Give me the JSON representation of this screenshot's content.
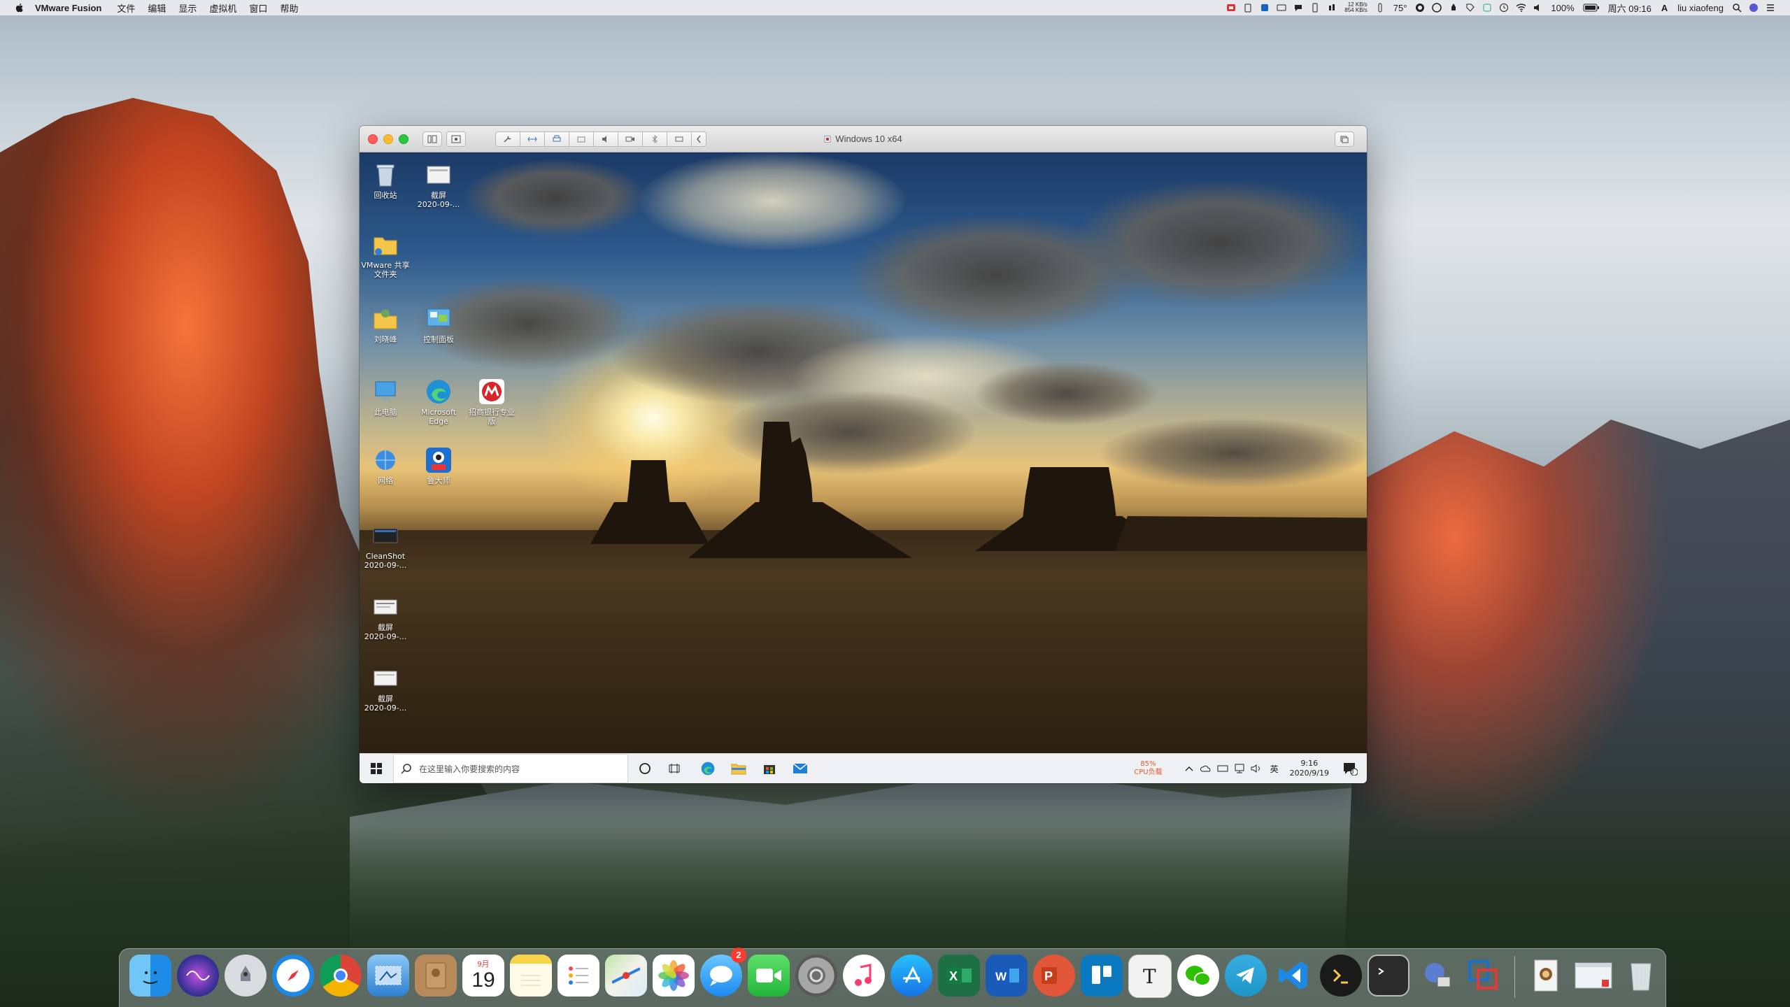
{
  "menubar": {
    "app_name": "VMware Fusion",
    "menus": [
      "文件",
      "编辑",
      "显示",
      "虚拟机",
      "窗口",
      "帮助"
    ],
    "net_up": "12 KB/s",
    "net_down": "854 KB/s",
    "temperature": "75°",
    "battery": "100%",
    "datetime": "周六 09:16",
    "input_source": "A",
    "username": "liu xiaofeng"
  },
  "vm_window": {
    "title": "Windows 10 x64"
  },
  "guest_desktop": {
    "icons": [
      {
        "label": "回收站",
        "name": "recycle-bin"
      },
      {
        "label": "截屏\n2020-09-...",
        "name": "screenshot-file-1"
      },
      {
        "label": "VMware 共享文件夹",
        "name": "vmware-shared-folders"
      },
      {
        "label": "刘晓峰",
        "name": "user-folder"
      },
      {
        "label": "控制面板",
        "name": "control-panel"
      },
      {
        "label": "此电脑",
        "name": "this-pc"
      },
      {
        "label": "Microsoft Edge",
        "name": "edge"
      },
      {
        "label": "招商银行专业版",
        "name": "cmb-bank"
      },
      {
        "label": "网络",
        "name": "network"
      },
      {
        "label": "鲁大师",
        "name": "ludashi"
      },
      {
        "label": "CleanShot\n2020-09-...",
        "name": "cleanshot-file"
      },
      {
        "label": "截屏\n2020-09-...",
        "name": "screenshot-file-2"
      },
      {
        "label": "截屏\n2020-09-...",
        "name": "screenshot-file-3"
      }
    ],
    "taskbar": {
      "search_placeholder": "在这里输入你要搜索的内容",
      "cpu_percent": "85%",
      "cpu_label": "CPU负载",
      "ime": "英",
      "time": "9:16",
      "date": "2020/9/19",
      "notification_count": "3"
    }
  },
  "dock": {
    "messages_badge": "2",
    "calendar_month": "9月",
    "calendar_day": "19",
    "items": [
      "Finder",
      "Siri",
      "Launchpad",
      "Safari",
      "Chrome",
      "Mail",
      "Contacts",
      "Calendar",
      "Notes",
      "Reminders",
      "Maps",
      "Photos",
      "Messages",
      "FaceTime",
      "System Preferences",
      "Music",
      "App Store",
      "Excel",
      "Word",
      "PowerPoint",
      "Trello",
      "Typora",
      "WeChat",
      "Telegram",
      "VS Code",
      "iTerm",
      "Terminal",
      "Network Radar",
      "VMware Fusion",
      "Preview",
      "Screenshot Window",
      "Trash"
    ]
  },
  "colors": {
    "accent_red": "#ff3b30",
    "cpu_orange": "#e55a2b",
    "win_blue": "#0078d7"
  }
}
